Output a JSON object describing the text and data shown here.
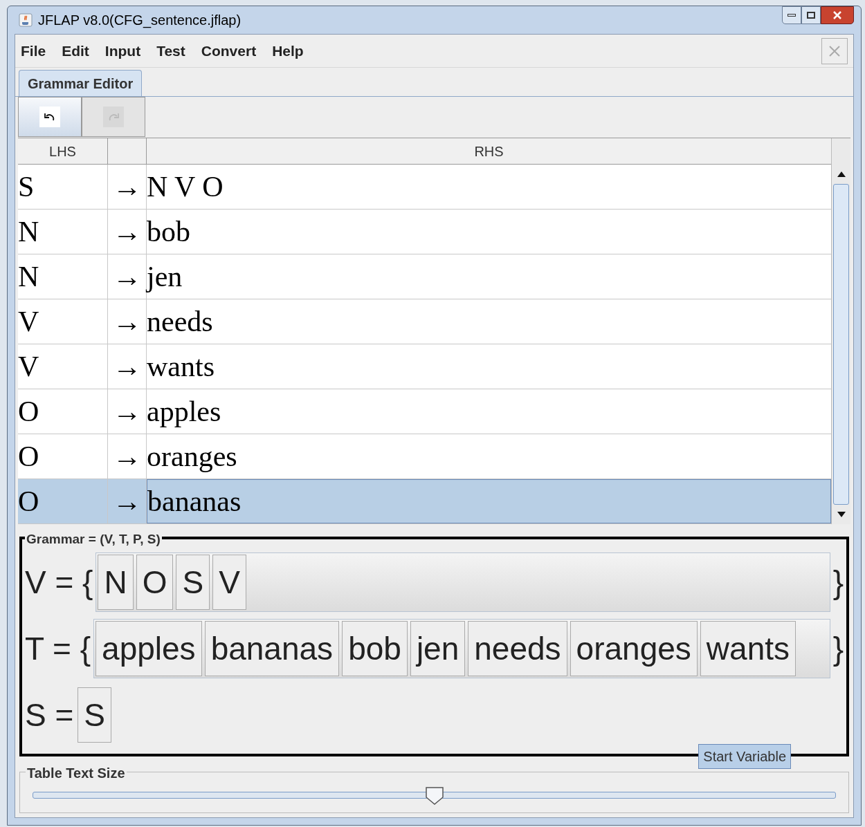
{
  "window": {
    "title": "JFLAP v8.0(CFG_sentence.jflap)"
  },
  "menu": [
    "File",
    "Edit",
    "Input",
    "Test",
    "Convert",
    "Help"
  ],
  "tabs": [
    {
      "label": "Grammar Editor",
      "selected": true
    }
  ],
  "toolbar": [
    {
      "kind": "undo",
      "disabled": false
    },
    {
      "kind": "redo",
      "disabled": true
    }
  ],
  "table": {
    "columns": [
      "LHS",
      "RHS"
    ],
    "rows": [
      {
        "lhs": "S",
        "arrow": "→",
        "rhs": "N V O",
        "selected": false
      },
      {
        "lhs": "N",
        "arrow": "→",
        "rhs": "bob",
        "selected": false
      },
      {
        "lhs": "N",
        "arrow": "→",
        "rhs": "jen",
        "selected": false
      },
      {
        "lhs": "V",
        "arrow": "→",
        "rhs": "needs",
        "selected": false
      },
      {
        "lhs": "V",
        "arrow": "→",
        "rhs": "wants",
        "selected": false
      },
      {
        "lhs": "O",
        "arrow": "→",
        "rhs": "apples",
        "selected": false
      },
      {
        "lhs": "O",
        "arrow": "→",
        "rhs": "oranges",
        "selected": false
      },
      {
        "lhs": "O",
        "arrow": "→",
        "rhs": "bananas",
        "selected": true
      }
    ]
  },
  "grammar": {
    "title": "Grammar = (V, T, P, S)",
    "sets": [
      {
        "label": "V = {",
        "items": [
          "N",
          "O",
          "S",
          "V"
        ],
        "close": "}"
      },
      {
        "label": "T = {",
        "items": [
          "apples",
          "bananas",
          "bob",
          "jen",
          "needs",
          "oranges",
          "wants"
        ],
        "close": "}"
      },
      {
        "label": "S =",
        "items": [
          "S"
        ]
      }
    ],
    "tooltip": "Start Variable"
  },
  "text_size": {
    "title": "Table Text Size",
    "level": 0.5
  }
}
